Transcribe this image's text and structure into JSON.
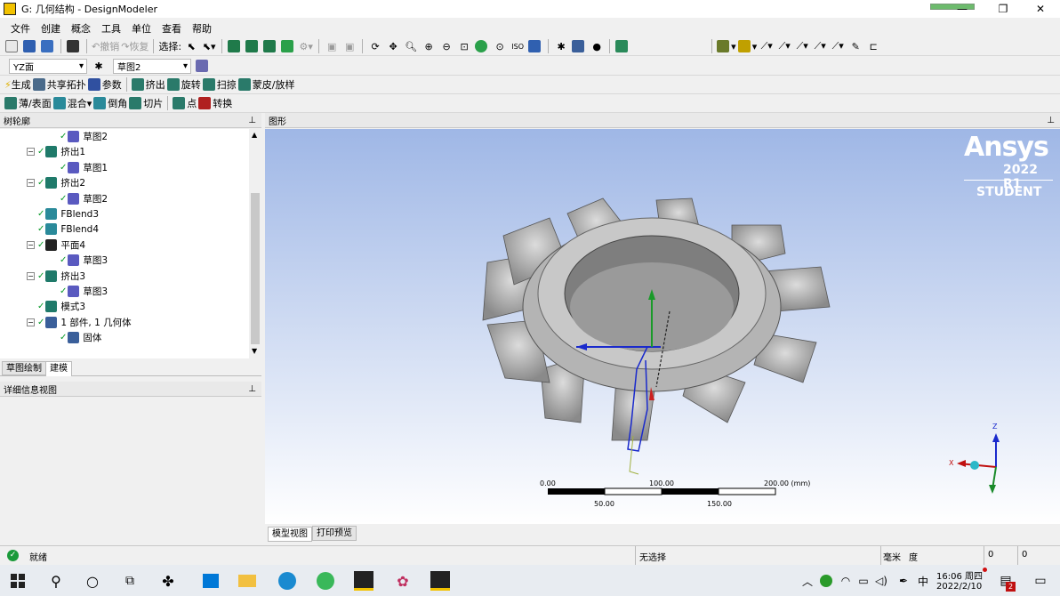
{
  "window": {
    "title": "G: 几何结构 - DesignModeler",
    "controls": [
      "—",
      "❐",
      "✕"
    ]
  },
  "menu": [
    "文件",
    "创建",
    "概念",
    "工具",
    "单位",
    "查看",
    "帮助"
  ],
  "toolbar1": {
    "undo": "撤销",
    "redo": "恢复",
    "select_label": "选择:"
  },
  "toolbar2": {
    "plane": "YZ面",
    "sketch": "草图2"
  },
  "toolbar3": [
    "生成",
    "共享拓扑",
    "参数",
    "挤出",
    "旋转",
    "扫掠",
    "蒙皮/放样"
  ],
  "toolbar4": [
    "薄/表面",
    "混合",
    "倒角",
    "切片",
    "点",
    "转换"
  ],
  "tree_panel": {
    "title": "树轮廓",
    "pin": "ᵖ"
  },
  "tree": [
    {
      "label": "草图2",
      "level": 3,
      "exp": "",
      "icon": "sketch"
    },
    {
      "label": "挤出1",
      "level": 2,
      "exp": "−",
      "icon": "extrude"
    },
    {
      "label": "草图1",
      "level": 3,
      "exp": "",
      "icon": "sketch"
    },
    {
      "label": "挤出2",
      "level": 2,
      "exp": "−",
      "icon": "extrude"
    },
    {
      "label": "草图2",
      "level": 3,
      "exp": "",
      "icon": "sketch"
    },
    {
      "label": "FBlend3",
      "level": 2,
      "exp": "",
      "icon": "blend"
    },
    {
      "label": "FBlend4",
      "level": 2,
      "exp": "",
      "icon": "blend"
    },
    {
      "label": "平面4",
      "level": 2,
      "exp": "−",
      "icon": "plane"
    },
    {
      "label": "草图3",
      "level": 3,
      "exp": "",
      "icon": "sketch"
    },
    {
      "label": "挤出3",
      "level": 2,
      "exp": "−",
      "icon": "extrude"
    },
    {
      "label": "草图3",
      "level": 3,
      "exp": "",
      "icon": "sketch"
    },
    {
      "label": "模式3",
      "level": 2,
      "exp": "",
      "icon": "pattern"
    },
    {
      "label": "1 部件, 1 几何体",
      "level": 2,
      "exp": "−",
      "icon": "part"
    },
    {
      "label": "固体",
      "level": 3,
      "exp": "",
      "icon": "solid"
    }
  ],
  "left_tabs": [
    "草图绘制",
    "建模"
  ],
  "details_panel": {
    "title": "详细信息视图"
  },
  "graphics_panel": {
    "title": "图形"
  },
  "brand": {
    "name": "Ansys",
    "version": "2022 R1",
    "edition": "STUDENT"
  },
  "scale": {
    "top": [
      "0.00",
      "100.00",
      "200.00 (mm)"
    ],
    "bottom": [
      "50.00",
      "150.00"
    ]
  },
  "triad": {
    "z": "Z",
    "x": "X"
  },
  "bottom_tabs": [
    "模型视图",
    "打印预览"
  ],
  "status": {
    "ready": "就绪",
    "selection": "无选择",
    "unit_length": "毫米",
    "unit_angle": "度",
    "v1": "0",
    "v2": "0"
  },
  "taskbar": {
    "time": "16:06 周四",
    "date": "2022/2/10",
    "ime": "中",
    "notif": "2"
  },
  "colors": {
    "viewport_top": "#9fb7e6",
    "accent": "#0078d7",
    "check": "#0a9a2a"
  }
}
